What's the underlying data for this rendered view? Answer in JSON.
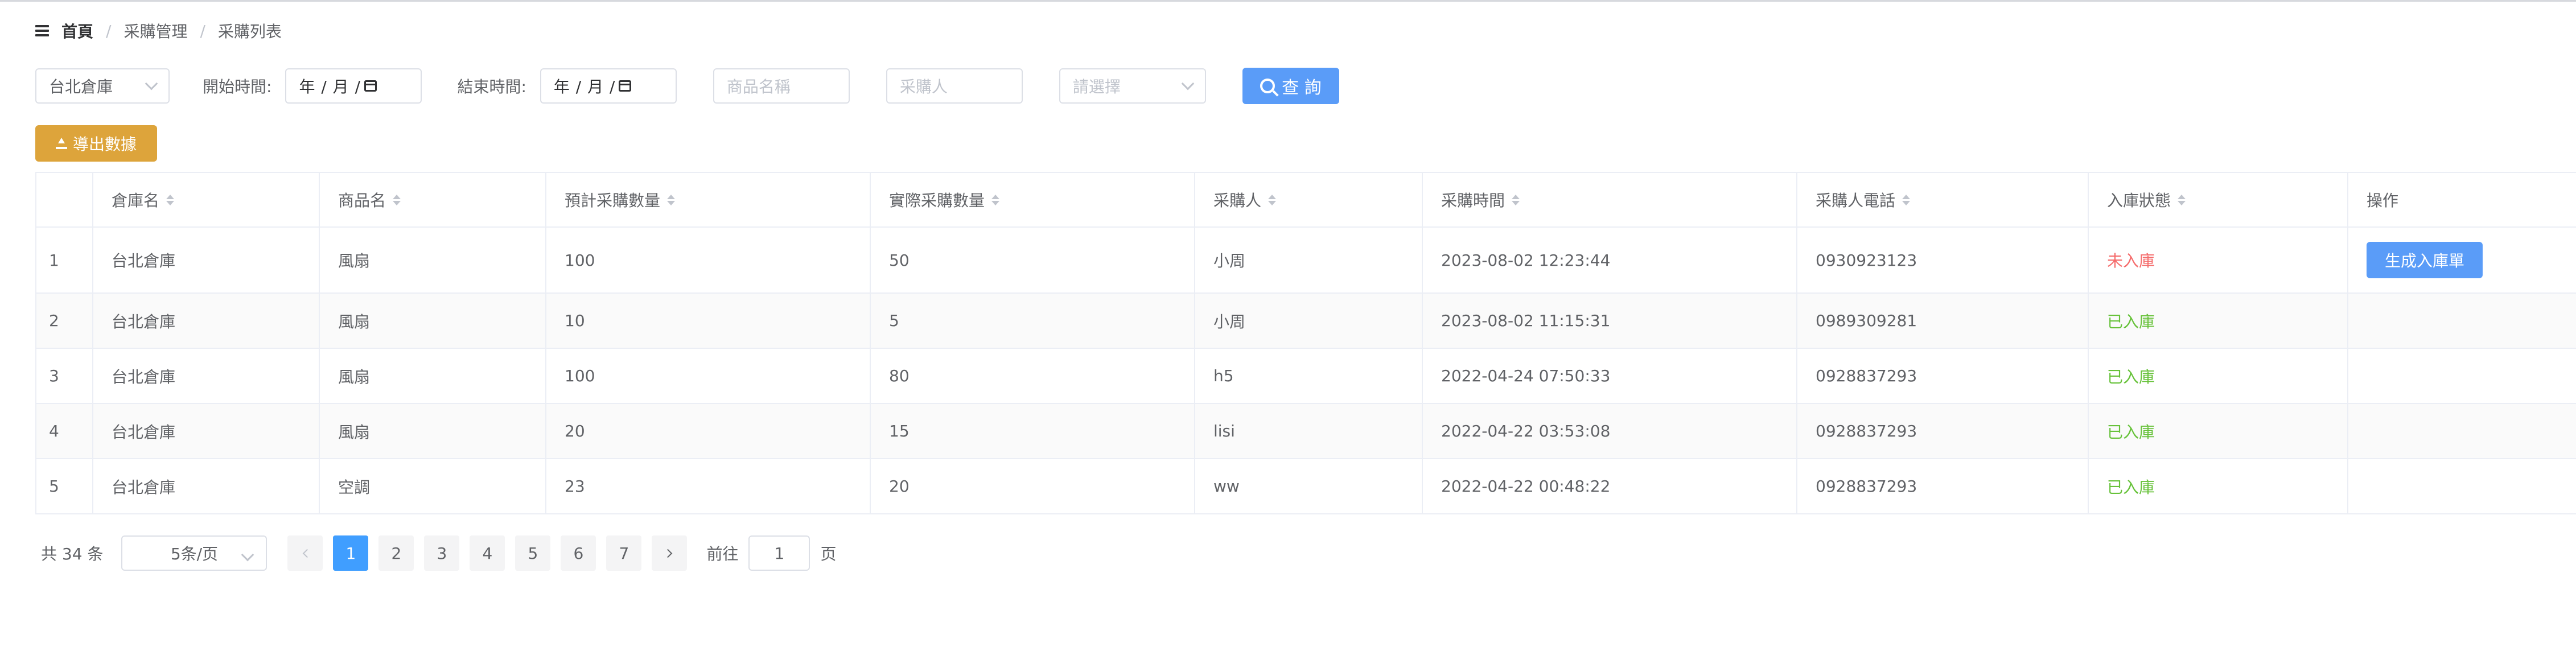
{
  "breadcrumb": {
    "items": [
      "首頁",
      "采購管理",
      "采購列表"
    ],
    "separator": "/"
  },
  "filters": {
    "warehouse_select": "台北倉庫",
    "start_label": "開始時間:",
    "start_date_text": "年 / 月 /",
    "end_label": "結束時間:",
    "end_date_text": "年 / 月 /",
    "product_placeholder": "商品名稱",
    "buyer_placeholder": "采購人",
    "status_placeholder": "請選擇",
    "query_label": "查 詢"
  },
  "toolbar": {
    "export_label": "導出數據"
  },
  "table": {
    "headers": [
      "倉庫名",
      "商品名",
      "預計采購數量",
      "實際采購數量",
      "采購人",
      "采購時間",
      "采購人電話",
      "入庫狀態",
      "操作"
    ],
    "action_label": "生成入庫單",
    "rows": [
      {
        "index": "1",
        "warehouse": "台北倉庫",
        "product": "風扇",
        "planned": "100",
        "actual": "50",
        "buyer": "小周",
        "time": "2023-08-02 12:23:44",
        "phone": "0930923123",
        "status": "未入庫"
      },
      {
        "index": "2",
        "warehouse": "台北倉庫",
        "product": "風扇",
        "planned": "10",
        "actual": "5",
        "buyer": "小周",
        "time": "2023-08-02 11:15:31",
        "phone": "0989309281",
        "status": "已入庫"
      },
      {
        "index": "3",
        "warehouse": "台北倉庫",
        "product": "風扇",
        "planned": "100",
        "actual": "80",
        "buyer": "h5",
        "time": "2022-04-24 07:50:33",
        "phone": "0928837293",
        "status": "已入庫"
      },
      {
        "index": "4",
        "warehouse": "台北倉庫",
        "product": "風扇",
        "planned": "20",
        "actual": "15",
        "buyer": "lisi",
        "time": "2022-04-22 03:53:08",
        "phone": "0928837293",
        "status": "已入庫"
      },
      {
        "index": "5",
        "warehouse": "台北倉庫",
        "product": "空調",
        "planned": "23",
        "actual": "20",
        "buyer": "ww",
        "time": "2022-04-22 00:48:22",
        "phone": "0928837293",
        "status": "已入庫"
      }
    ]
  },
  "pagination": {
    "total_text": "共 34 条",
    "page_size": "5条/页",
    "pages": [
      "1",
      "2",
      "3",
      "4",
      "5",
      "6",
      "7"
    ],
    "current": "1",
    "goto_label": "前往",
    "goto_value": "1",
    "page_suffix": "页"
  },
  "colors": {
    "primary": "#409eff",
    "warning": "#dda43b",
    "danger": "#f56c6c",
    "success": "#67c23a"
  },
  "icons": [
    "hamburger-icon",
    "calendar-icon",
    "search-icon",
    "upload-icon",
    "sort-icon",
    "chevron-down-icon",
    "chevron-left-icon",
    "chevron-right-icon"
  ]
}
